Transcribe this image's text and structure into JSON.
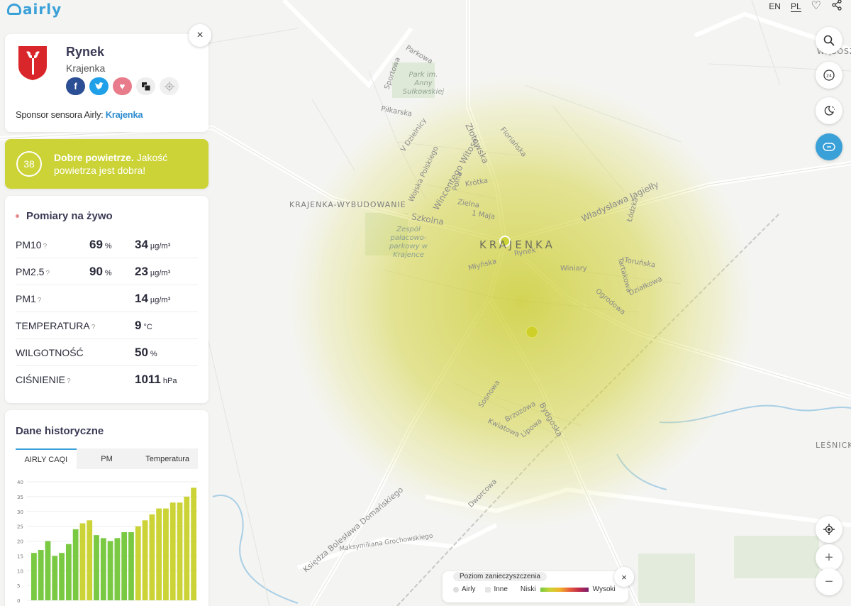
{
  "header": {
    "logo_text": "airly",
    "lang_en": "EN",
    "lang_pl": "PL"
  },
  "station": {
    "name": "Rynek",
    "city": "Krajenka",
    "sponsor_label": "Sponsor sensora Airly:",
    "sponsor_name": "Krajenka",
    "close": "×"
  },
  "caqi": {
    "value": "38",
    "headline": "Dobre powietrze.",
    "description": "Jakość powietrza jest dobra!",
    "color": "#ccd336"
  },
  "live": {
    "title": "Pomiary na żywo",
    "rows": [
      {
        "name": "PM10",
        "help": "?",
        "percent": "69",
        "percent_unit": "%",
        "value": "34",
        "unit": "µg/m³"
      },
      {
        "name": "PM2.5",
        "help": "?",
        "percent": "90",
        "percent_unit": "%",
        "value": "23",
        "unit": "µg/m³"
      },
      {
        "name": "PM1",
        "help": "?",
        "percent": "",
        "percent_unit": "",
        "value": "14",
        "unit": "µg/m³"
      },
      {
        "name": "TEMPERATURA",
        "help": "?",
        "percent": "",
        "percent_unit": "",
        "value": "9",
        "unit": "°C"
      },
      {
        "name": "WILGOTNOŚĆ",
        "help": "",
        "percent": "",
        "percent_unit": "",
        "value": "50",
        "unit": "%"
      },
      {
        "name": "CIŚNIENIE",
        "help": "?",
        "percent": "",
        "percent_unit": "",
        "value": "1011",
        "unit": "hPa"
      }
    ]
  },
  "history": {
    "title": "Dane historyczne",
    "tabs": [
      "AIRLY CAQI",
      "PM",
      "Temperatura"
    ]
  },
  "chart_data": {
    "type": "bar",
    "ylim": [
      0,
      40
    ],
    "yticks": [
      0,
      5,
      10,
      15,
      20,
      25,
      30,
      35,
      40
    ],
    "values": [
      16,
      17,
      20,
      15,
      16,
      19,
      24,
      26,
      27,
      22,
      21,
      20,
      21,
      23,
      23,
      25,
      27,
      29,
      31,
      31,
      33,
      33,
      35,
      38
    ],
    "colors": {
      "good": "#7ac943",
      "moderate": "#ccd336"
    }
  },
  "map_labels": {
    "parkowa": "Parkowa",
    "park": "Park im. Anny Sułkowskiej",
    "sportowa": "Sportowa",
    "pilkarska": "Piłkarska",
    "dzielnicy": "V Dzielnicy",
    "wojska": "Wojska Polskiego",
    "witosa": "Wincentego Witosa",
    "zlotowska": "Złotowska",
    "florianska": "Floriańska",
    "polna": "Polna",
    "krotka": "Krótka",
    "zielna": "Zielna",
    "wybudowanie": "KRAJENKA-WYBUDOWANIE",
    "szkolna": "Szkolna",
    "maja": "1 Maja",
    "zespol": "Zespół pałacowo-parkowy w Krajence",
    "town": "KRAJENKA",
    "rynek": "Rynek",
    "mlynska": "Młyńska",
    "jagielly": "Władysława Jagiełły",
    "lodzka": "Łódzka",
    "torunska": "Toruńska",
    "winiary": "Winiary",
    "tartakowa": "Tartakowa",
    "dzialkowa": "Działkowa",
    "ogrodowa": "Ogrodowa",
    "sosnowa": "Sosnowa",
    "brzozowa": "Brzozowa",
    "kwiatowa": "Kwiatowa",
    "lipowa": "Lipowa",
    "bydgoska": "Bydgoska",
    "dworcowa": "Dworcowa",
    "domanskiego": "Księdza Bolesława Domańskiego",
    "grochowskiego": "Maksymiliana Grochowskiego",
    "wasosz": "WĄSOSZ",
    "lesnick": "LEŚNICK"
  },
  "legend": {
    "title": "Poziom zanieczyszczenia",
    "airly": "Airly",
    "inne": "Inne",
    "low": "Niski",
    "high": "Wysoki"
  }
}
